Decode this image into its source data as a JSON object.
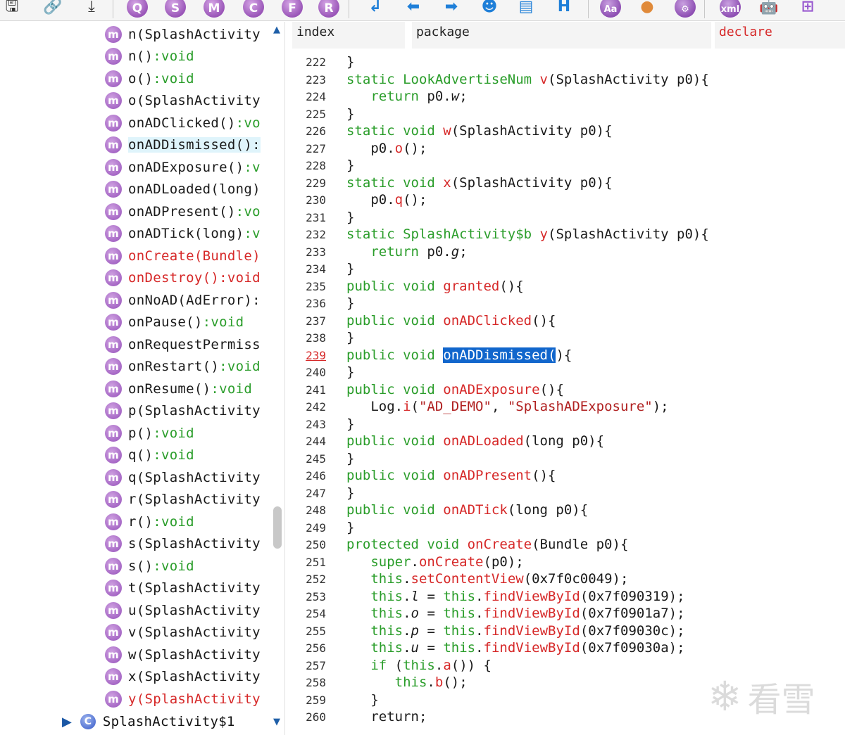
{
  "toolbar": {
    "icons": [
      {
        "name": "save-icon",
        "glyph": "🖫"
      },
      {
        "name": "sync-link-icon",
        "glyph": "🔗"
      },
      {
        "name": "export-icon",
        "glyph": "⤓"
      },
      {
        "name": "search-q-icon",
        "glyph": "Q"
      },
      {
        "name": "search-s-icon",
        "glyph": "S"
      },
      {
        "name": "search-m-icon",
        "glyph": "M"
      },
      {
        "name": "search-c-icon",
        "glyph": "C"
      },
      {
        "name": "search-f-icon",
        "glyph": "F"
      },
      {
        "name": "search-r-icon",
        "glyph": "R"
      },
      {
        "name": "goto-line-icon",
        "glyph": "↲"
      },
      {
        "name": "back-arrow-icon",
        "glyph": "⬅"
      },
      {
        "name": "forward-arrow-icon",
        "glyph": "➡"
      },
      {
        "name": "debug-person-icon",
        "glyph": "☻"
      },
      {
        "name": "code-doc-icon",
        "glyph": "▤"
      },
      {
        "name": "hex-h-icon",
        "glyph": "H"
      },
      {
        "name": "font-aa-icon",
        "glyph": "Aa"
      },
      {
        "name": "color-dots-icon",
        "glyph": "●"
      },
      {
        "name": "settings-gear-icon",
        "glyph": "⚙"
      },
      {
        "name": "xml-icon",
        "glyph": "xml"
      },
      {
        "name": "android-icon",
        "glyph": "🤖"
      },
      {
        "name": "windows-icon",
        "glyph": "⊞"
      }
    ]
  },
  "tree": {
    "items": [
      {
        "icon": "m",
        "name": "n(SplashActivity",
        "ret": "",
        "style": "normal"
      },
      {
        "icon": "m",
        "name": "n()",
        "ret": ":void",
        "style": "normal"
      },
      {
        "icon": "m",
        "name": "o()",
        "ret": ":void",
        "style": "normal"
      },
      {
        "icon": "m",
        "name": "o(SplashActivity",
        "ret": "",
        "style": "normal"
      },
      {
        "icon": "m",
        "name": "onADClicked()",
        "ret": ":vo",
        "style": "normal"
      },
      {
        "icon": "m",
        "name": "onADDismissed():",
        "ret": "",
        "style": "selected"
      },
      {
        "icon": "m",
        "name": "onADExposure()",
        "ret": ":v",
        "style": "normal"
      },
      {
        "icon": "m",
        "name": "onADLoaded(long)",
        "ret": "",
        "style": "normal"
      },
      {
        "icon": "m",
        "name": "onADPresent()",
        "ret": ":vo",
        "style": "normal"
      },
      {
        "icon": "m",
        "name": "onADTick(long)",
        "ret": ":v",
        "style": "normal"
      },
      {
        "icon": "m",
        "name": "onCreate(Bundle)",
        "ret": "",
        "style": "red"
      },
      {
        "icon": "m",
        "name": "onDestroy()",
        "ret": ":void",
        "style": "red"
      },
      {
        "icon": "m",
        "name": "onNoAD(AdError):",
        "ret": "",
        "style": "normal"
      },
      {
        "icon": "m",
        "name": "onPause()",
        "ret": ":void",
        "style": "normal"
      },
      {
        "icon": "m",
        "name": "onRequestPermiss",
        "ret": "",
        "style": "normal"
      },
      {
        "icon": "m",
        "name": "onRestart()",
        "ret": ":void",
        "style": "normal"
      },
      {
        "icon": "m",
        "name": "onResume()",
        "ret": ":void",
        "style": "normal"
      },
      {
        "icon": "m",
        "name": "p(SplashActivity",
        "ret": "",
        "style": "normal"
      },
      {
        "icon": "m",
        "name": "p()",
        "ret": ":void",
        "style": "normal"
      },
      {
        "icon": "m",
        "name": "q()",
        "ret": ":void",
        "style": "normal"
      },
      {
        "icon": "m",
        "name": "q(SplashActivity",
        "ret": "",
        "style": "normal"
      },
      {
        "icon": "m",
        "name": "r(SplashActivity",
        "ret": "",
        "style": "normal"
      },
      {
        "icon": "m",
        "name": "r()",
        "ret": ":void",
        "style": "normal"
      },
      {
        "icon": "m",
        "name": "s(SplashActivity",
        "ret": "",
        "style": "normal"
      },
      {
        "icon": "m",
        "name": "s()",
        "ret": ":void",
        "style": "normal"
      },
      {
        "icon": "m",
        "name": "t(SplashActivity",
        "ret": "",
        "style": "normal"
      },
      {
        "icon": "m",
        "name": "u(SplashActivity",
        "ret": "",
        "style": "normal"
      },
      {
        "icon": "m",
        "name": "v(SplashActivity",
        "ret": "",
        "style": "normal"
      },
      {
        "icon": "m",
        "name": "w(SplashActivity",
        "ret": "",
        "style": "normal"
      },
      {
        "icon": "m",
        "name": "x(SplashActivity",
        "ret": "",
        "style": "normal"
      },
      {
        "icon": "m",
        "name": "y(SplashActivity",
        "ret": "",
        "style": "red"
      }
    ],
    "class_node": {
      "arrow": "▶",
      "icon": "C",
      "label": "SplashActivity$1"
    },
    "scroll_up": "▲",
    "scroll_down": "▼"
  },
  "code": {
    "tabs": [
      {
        "label": "index",
        "style": "normal"
      },
      {
        "label": "package",
        "style": "normal"
      },
      {
        "label": "declare",
        "style": "red"
      }
    ],
    "current_line": 239,
    "lines": [
      {
        "n": "222",
        "t": [
          [
            "}",
            ""
          ]
        ]
      },
      {
        "n": "223",
        "t": [
          [
            "static",
            "kw"
          ],
          [
            " LookAdvertiseNum ",
            "kw"
          ],
          [
            "v",
            "fn"
          ],
          [
            "(SplashActivity p0){",
            ""
          ]
        ]
      },
      {
        "n": "224",
        "t": [
          [
            "   ",
            ""
          ],
          [
            "return",
            "kw"
          ],
          [
            " p0.",
            ""
          ],
          [
            "w",
            "fld"
          ],
          [
            ";",
            ""
          ]
        ]
      },
      {
        "n": "225",
        "t": [
          [
            "}",
            ""
          ]
        ]
      },
      {
        "n": "226",
        "t": [
          [
            "static void ",
            "kw"
          ],
          [
            "w",
            "fn"
          ],
          [
            "(SplashActivity p0){",
            ""
          ]
        ]
      },
      {
        "n": "227",
        "t": [
          [
            "   p0.",
            ""
          ],
          [
            "o",
            "fn"
          ],
          [
            "();",
            ""
          ]
        ]
      },
      {
        "n": "228",
        "t": [
          [
            "}",
            ""
          ]
        ]
      },
      {
        "n": "229",
        "t": [
          [
            "static void ",
            "kw"
          ],
          [
            "x",
            "fn"
          ],
          [
            "(SplashActivity p0){",
            ""
          ]
        ]
      },
      {
        "n": "230",
        "t": [
          [
            "   p0.",
            ""
          ],
          [
            "q",
            "fn"
          ],
          [
            "();",
            ""
          ]
        ]
      },
      {
        "n": "231",
        "t": [
          [
            "}",
            ""
          ]
        ]
      },
      {
        "n": "232",
        "t": [
          [
            "static",
            "kw"
          ],
          [
            " SplashActivity$b ",
            "kw"
          ],
          [
            "y",
            "fn"
          ],
          [
            "(SplashActivity p0){",
            ""
          ]
        ]
      },
      {
        "n": "233",
        "t": [
          [
            "   ",
            ""
          ],
          [
            "return",
            "kw"
          ],
          [
            " p0.",
            ""
          ],
          [
            "g",
            "fld"
          ],
          [
            ";",
            ""
          ]
        ]
      },
      {
        "n": "234",
        "t": [
          [
            "}",
            ""
          ]
        ]
      },
      {
        "n": "235",
        "t": [
          [
            "public void ",
            "kw"
          ],
          [
            "granted",
            "fn"
          ],
          [
            "(){",
            ""
          ]
        ]
      },
      {
        "n": "236",
        "t": [
          [
            "}",
            ""
          ]
        ]
      },
      {
        "n": "237",
        "t": [
          [
            "public void ",
            "kw"
          ],
          [
            "onADClicked",
            "fn"
          ],
          [
            "(){",
            ""
          ]
        ]
      },
      {
        "n": "238",
        "t": [
          [
            "}",
            ""
          ]
        ]
      },
      {
        "n": "239",
        "t": [
          [
            "public void ",
            "kw"
          ],
          [
            "onADDismissed(",
            "hl"
          ],
          [
            "){",
            ""
          ]
        ]
      },
      {
        "n": "240",
        "t": [
          [
            "}",
            ""
          ]
        ]
      },
      {
        "n": "241",
        "t": [
          [
            "public void ",
            "kw"
          ],
          [
            "onADExposure",
            "fn"
          ],
          [
            "(){",
            ""
          ]
        ]
      },
      {
        "n": "242",
        "t": [
          [
            "   Log.",
            ""
          ],
          [
            "i",
            "fn"
          ],
          [
            "(",
            ""
          ],
          [
            "\"AD_DEMO\"",
            "str"
          ],
          [
            ", ",
            ""
          ],
          [
            "\"SplashADExposure\"",
            "str"
          ],
          [
            ");",
            ""
          ]
        ]
      },
      {
        "n": "243",
        "t": [
          [
            "}",
            ""
          ]
        ]
      },
      {
        "n": "244",
        "t": [
          [
            "public void ",
            "kw"
          ],
          [
            "onADLoaded",
            "fn"
          ],
          [
            "(long p0){",
            ""
          ]
        ]
      },
      {
        "n": "245",
        "t": [
          [
            "}",
            ""
          ]
        ]
      },
      {
        "n": "246",
        "t": [
          [
            "public void ",
            "kw"
          ],
          [
            "onADPresent",
            "fn"
          ],
          [
            "(){",
            ""
          ]
        ]
      },
      {
        "n": "247",
        "t": [
          [
            "}",
            ""
          ]
        ]
      },
      {
        "n": "248",
        "t": [
          [
            "public void ",
            "kw"
          ],
          [
            "onADTick",
            "fn"
          ],
          [
            "(long p0){",
            ""
          ]
        ]
      },
      {
        "n": "249",
        "t": [
          [
            "}",
            ""
          ]
        ]
      },
      {
        "n": "250",
        "t": [
          [
            "protected void ",
            "kw"
          ],
          [
            "onCreate",
            "fn"
          ],
          [
            "(Bundle p0){",
            ""
          ]
        ]
      },
      {
        "n": "251",
        "t": [
          [
            "   ",
            ""
          ],
          [
            "super",
            "kw"
          ],
          [
            ".",
            ""
          ],
          [
            "onCreate",
            "fn"
          ],
          [
            "(p0);",
            ""
          ]
        ]
      },
      {
        "n": "252",
        "t": [
          [
            "   ",
            ""
          ],
          [
            "this",
            "kw"
          ],
          [
            ".",
            ""
          ],
          [
            "setContentView",
            "fn"
          ],
          [
            "(0x7f0c0049);",
            ""
          ]
        ]
      },
      {
        "n": "253",
        "t": [
          [
            "   ",
            ""
          ],
          [
            "this",
            "kw"
          ],
          [
            ".",
            ""
          ],
          [
            "l",
            "fld"
          ],
          [
            " = ",
            ""
          ],
          [
            "this",
            "kw"
          ],
          [
            ".",
            ""
          ],
          [
            "findViewById",
            "fn"
          ],
          [
            "(0x7f090319);",
            ""
          ]
        ]
      },
      {
        "n": "254",
        "t": [
          [
            "   ",
            ""
          ],
          [
            "this",
            "kw"
          ],
          [
            ".",
            ""
          ],
          [
            "o",
            "fld"
          ],
          [
            " = ",
            ""
          ],
          [
            "this",
            "kw"
          ],
          [
            ".",
            ""
          ],
          [
            "findViewById",
            "fn"
          ],
          [
            "(0x7f0901a7);",
            ""
          ]
        ]
      },
      {
        "n": "255",
        "t": [
          [
            "   ",
            ""
          ],
          [
            "this",
            "kw"
          ],
          [
            ".",
            ""
          ],
          [
            "p",
            "fld"
          ],
          [
            " = ",
            ""
          ],
          [
            "this",
            "kw"
          ],
          [
            ".",
            ""
          ],
          [
            "findViewById",
            "fn"
          ],
          [
            "(0x7f09030c);",
            ""
          ]
        ]
      },
      {
        "n": "256",
        "t": [
          [
            "   ",
            ""
          ],
          [
            "this",
            "kw"
          ],
          [
            ".",
            ""
          ],
          [
            "u",
            "fld"
          ],
          [
            " = ",
            ""
          ],
          [
            "this",
            "kw"
          ],
          [
            ".",
            ""
          ],
          [
            "findViewById",
            "fn"
          ],
          [
            "(0x7f09030a);",
            ""
          ]
        ]
      },
      {
        "n": "257",
        "t": [
          [
            "   ",
            ""
          ],
          [
            "if",
            "kw"
          ],
          [
            " (",
            ""
          ],
          [
            "this",
            "kw"
          ],
          [
            ".",
            ""
          ],
          [
            "a",
            "fn"
          ],
          [
            "()) {",
            ""
          ]
        ]
      },
      {
        "n": "258",
        "t": [
          [
            "      ",
            ""
          ],
          [
            "this",
            "kw"
          ],
          [
            ".",
            ""
          ],
          [
            "b",
            "fn"
          ],
          [
            "();",
            ""
          ]
        ]
      },
      {
        "n": "259",
        "t": [
          [
            "   }",
            ""
          ]
        ]
      },
      {
        "n": "260",
        "t": [
          [
            "   return;",
            ""
          ]
        ]
      }
    ]
  },
  "watermark": {
    "glyph": "❄",
    "text": "看雪"
  }
}
